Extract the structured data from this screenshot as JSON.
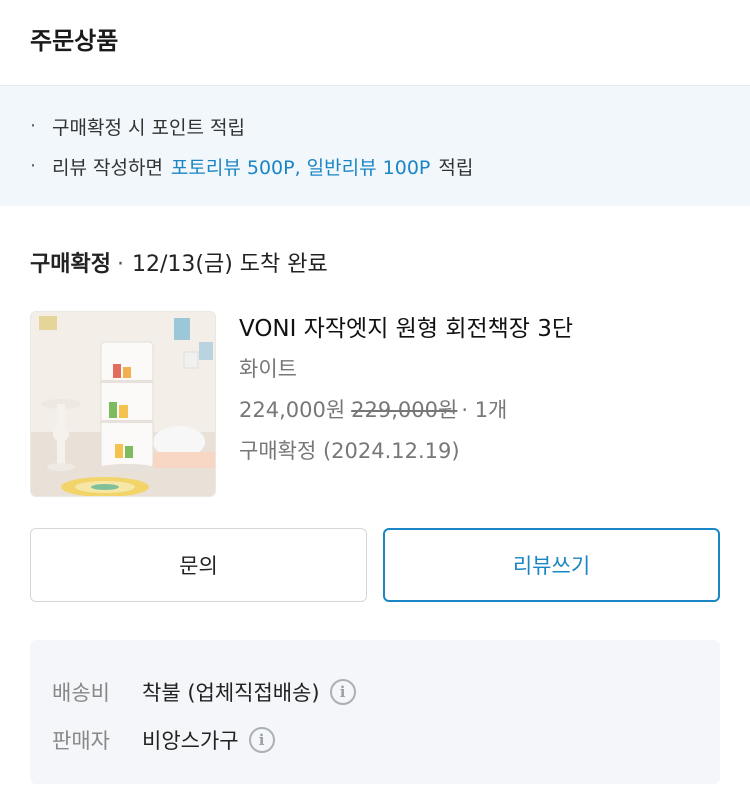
{
  "header": {
    "title": "주문상품"
  },
  "notice": {
    "items": [
      {
        "bullet": "·",
        "text": "구매확정 시 포인트 적립"
      },
      {
        "bullet": "·",
        "text": "리뷰 작성하면",
        "highlight": "포토리뷰 500P, 일반리뷰 100P",
        "tail": "적립"
      }
    ]
  },
  "order": {
    "status": "구매확정",
    "separator": "·",
    "delivery": "12/13(금) 도착 완료"
  },
  "product": {
    "name": "VONI 자작엣지 원형 회전책장 3단",
    "option": "화이트",
    "price": "224,000원",
    "original_price": "229,000원",
    "quantity": "· 1개",
    "confirm": "구매확정 (2024.12.19)"
  },
  "buttons": {
    "inquiry": "문의",
    "review": "리뷰쓰기"
  },
  "shipping": {
    "fee_label": "배송비",
    "fee_value": "착불 (업체직접배송)",
    "seller_label": "판매자",
    "seller_value": "비앙스가구",
    "info_icon": "i"
  },
  "colors": {
    "accent": "#1b86c4",
    "notice_bg": "#f2f7fb",
    "infobox_bg": "#f4f6f9"
  }
}
